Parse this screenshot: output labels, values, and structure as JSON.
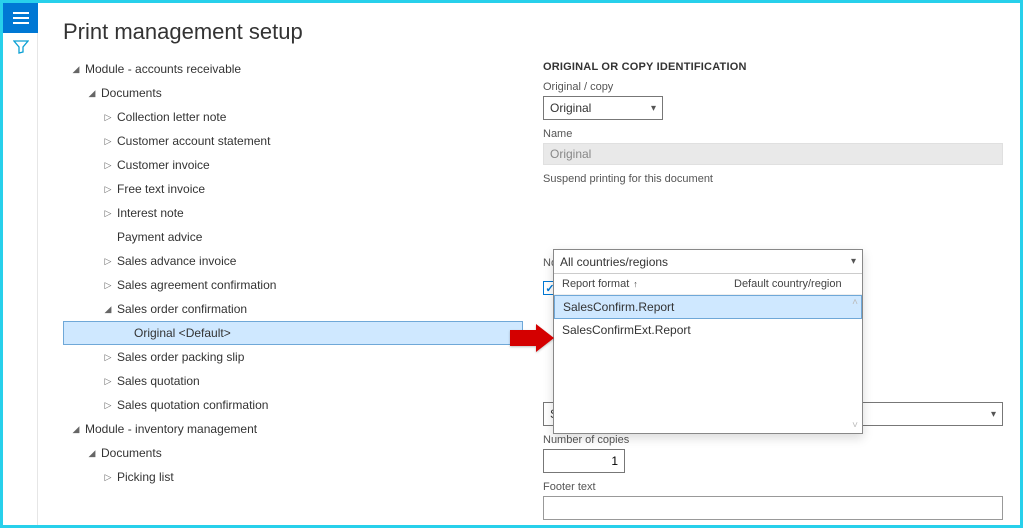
{
  "page": {
    "title": "Print management setup"
  },
  "tree": {
    "module_ar": "Module - accounts receivable",
    "documents1": "Documents",
    "items_ar": {
      "collection_letter": "Collection letter note",
      "cust_acct_stmt": "Customer account statement",
      "cust_invoice": "Customer invoice",
      "free_text": "Free text invoice",
      "interest_note": "Interest note",
      "payment_advice": "Payment advice",
      "sales_adv_inv": "Sales advance invoice",
      "sales_agr_conf": "Sales agreement confirmation",
      "sales_order_conf": "Sales order confirmation",
      "original_default": "Original <Default>",
      "sales_pack_slip": "Sales order packing slip",
      "sales_quotation": "Sales quotation",
      "sales_quot_conf": "Sales quotation confirmation"
    },
    "module_inv": "Module - inventory management",
    "documents2": "Documents",
    "items_inv": {
      "picking_list": "Picking list"
    }
  },
  "form": {
    "section": "ORIGINAL OR COPY IDENTIFICATION",
    "orig_copy_label": "Original / copy",
    "orig_copy_value": "Original",
    "name_label": "Name",
    "name_value": "Original",
    "suspend_label": "Suspend printing for this document",
    "suspend_no": "No",
    "report_format_value": "SalesConfirm.Report",
    "copies_label": "Number of copies",
    "copies_value": "1",
    "footer_label": "Footer text"
  },
  "popover": {
    "filter_value": "All countries/regions",
    "col_report": "Report format",
    "col_region": "Default country/region",
    "options": {
      "0": "SalesConfirm.Report",
      "1": "SalesConfirmExt.Report"
    }
  }
}
